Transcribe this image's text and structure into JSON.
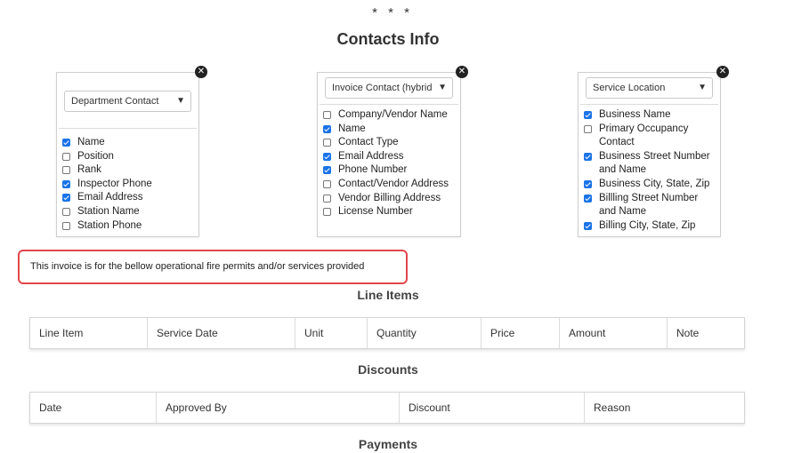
{
  "header": {
    "stars": "* * *",
    "title": "Contacts Info"
  },
  "cards": [
    {
      "select_value": "Department Contact",
      "items": [
        {
          "label": "Name",
          "checked": true
        },
        {
          "label": "Position",
          "checked": false
        },
        {
          "label": "Rank",
          "checked": false
        },
        {
          "label": "Inspector Phone",
          "checked": true
        },
        {
          "label": "Email Address",
          "checked": true
        },
        {
          "label": "Station Name",
          "checked": false
        },
        {
          "label": "Station Phone",
          "checked": false
        }
      ]
    },
    {
      "select_value": "Invoice Contact (hybrid",
      "items": [
        {
          "label": "Company/Vendor Name",
          "checked": false
        },
        {
          "label": "Name",
          "checked": true
        },
        {
          "label": "Contact Type",
          "checked": false
        },
        {
          "label": "Email Address",
          "checked": true
        },
        {
          "label": "Phone Number",
          "checked": true
        },
        {
          "label": "Contact/Vendor Address",
          "checked": false
        },
        {
          "label": "Vendor Billing Address",
          "checked": false
        },
        {
          "label": "License Number",
          "checked": false
        }
      ]
    },
    {
      "select_value": "Service Location",
      "items": [
        {
          "label": "Business Name",
          "checked": true
        },
        {
          "label": "Primary Occupancy Contact",
          "checked": false
        },
        {
          "label": "Business Street Number and Name",
          "checked": true
        },
        {
          "label": "Business City, State, Zip",
          "checked": true
        },
        {
          "label": "Billling Street Number and Name",
          "checked": true
        },
        {
          "label": "Billing City, State, Zip",
          "checked": true
        }
      ]
    }
  ],
  "note": "This invoice is for the bellow operational fire permits and/or services provided",
  "line_items": {
    "title": "Line Items",
    "columns": [
      "Line Item",
      "Service Date",
      "Unit",
      "Quantity",
      "Price",
      "Amount",
      "Note"
    ]
  },
  "discounts": {
    "title": "Discounts",
    "columns": [
      "Date",
      "Approved By",
      "Discount",
      "Reason"
    ]
  },
  "payments": {
    "title": "Payments"
  }
}
